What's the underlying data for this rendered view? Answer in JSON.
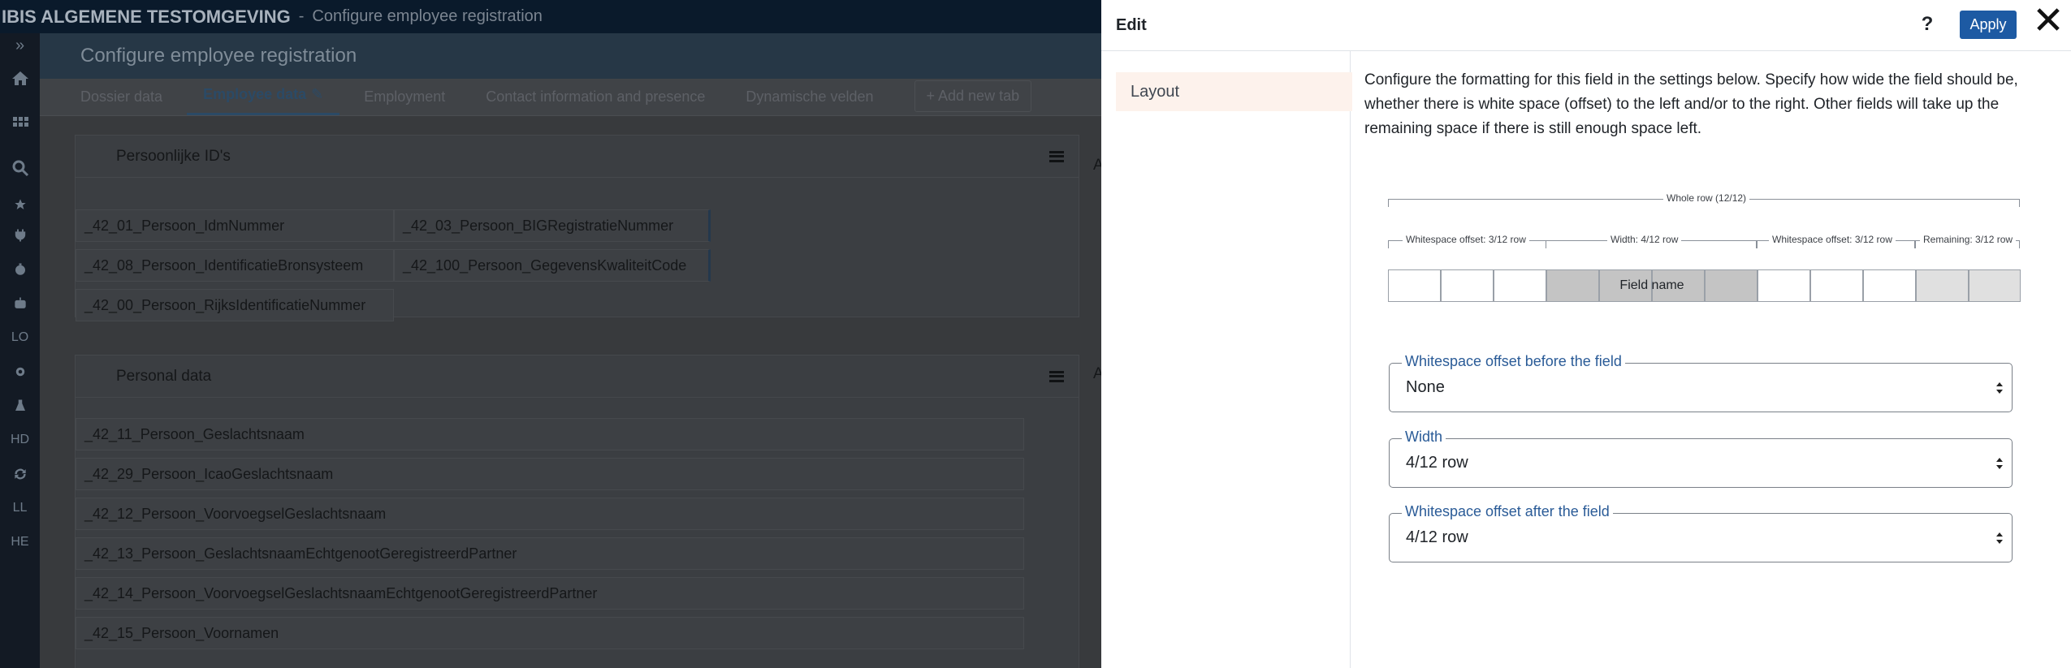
{
  "header": {
    "app_title": "IBIS ALGEMENE TESTOMGEVING",
    "separator": "-",
    "breadcrumb": "Configure employee registration"
  },
  "sidebar": {
    "items": [
      {
        "icon": "chevrons-right-icon"
      },
      {
        "icon": "home-icon"
      },
      {
        "icon": "grid-icon"
      },
      {
        "icon": "search-icon"
      },
      {
        "icon": "star-icon"
      },
      {
        "icon": "plug-icon"
      },
      {
        "icon": "clock-icon"
      },
      {
        "icon": "robot-icon"
      },
      {
        "label": "LO"
      },
      {
        "icon": "gear-icon"
      },
      {
        "icon": "flask-icon"
      },
      {
        "label": "HD"
      },
      {
        "icon": "sync-icon"
      },
      {
        "label": "LL"
      },
      {
        "label": "HE"
      }
    ]
  },
  "page": {
    "title": "Configure employee registration",
    "tabs": [
      {
        "label": "Dossier data"
      },
      {
        "label": "Employee data",
        "active": true
      },
      {
        "label": "Employment"
      },
      {
        "label": "Contact information and presence"
      },
      {
        "label": "Dynamische velden"
      }
    ],
    "add_tab": "+ Add new tab"
  },
  "cards": {
    "ids": {
      "title": "Persoonlijke ID's",
      "fields": [
        "_42_01_Persoon_IdmNummer",
        "_42_03_Persoon_BIGRegistratieNummer",
        "_42_08_Persoon_IdentificatieBronsysteem",
        "_42_100_Persoon_GegevensKwaliteitCode",
        "_42_00_Persoon_RijksIdentificatieNummer"
      ]
    },
    "personal": {
      "title": "Personal data",
      "fields": [
        "_42_11_Persoon_Geslachtsnaam",
        "_42_29_Persoon_IcaoGeslachtsnaam",
        "_42_12_Persoon_VoorvoegselGeslachtsnaam",
        "_42_13_Persoon_GeslachtsnaamEchtgenootGeregistreerdPartner",
        "_42_14_Persoon_VoorvoegselGeslachtsnaamEchtgenootGeregistreerdPartner",
        "_42_15_Persoon_Voornamen"
      ]
    },
    "right_col_initial_1": "A",
    "right_col_initial_2": "A"
  },
  "panel": {
    "title": "Edit",
    "help": "?",
    "apply": "Apply",
    "nav_item": "Layout",
    "description": "Configure the formatting for this field in the settings below. Specify how wide the field should be, whether there is white space (offset) to the left and/or to the right. Other fields will take up the remaining space if there is still enough space left.",
    "diagram": {
      "whole_row": "Whole row (12/12)",
      "offset_before": "Whitespace offset: 3/12 row",
      "width": "Width: 4/12 row",
      "offset_after": "Whitespace offset: 3/12 row",
      "remaining": "Remaining: 3/12 row",
      "field_name": "Field name"
    },
    "selects": {
      "before": {
        "label": "Whitespace offset before the field",
        "value": "None"
      },
      "width": {
        "label": "Width",
        "value": "4/12 row"
      },
      "after": {
        "label": "Whitespace offset after the field",
        "value": "4/12 row"
      }
    },
    "colors": {
      "apply": "#1d5aa3",
      "legend": "#2a5b97",
      "nav_active_bg": "#fdf2ec"
    }
  }
}
